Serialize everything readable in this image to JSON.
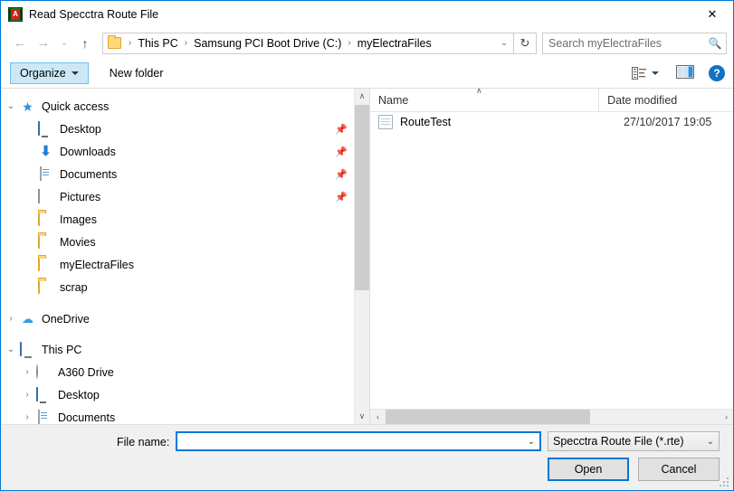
{
  "window": {
    "title": "Read Specctra Route File",
    "icon": "app-chip-icon",
    "close_label": "✕",
    "accent_color": "#0078d7"
  },
  "nav": {
    "back": "←",
    "forward": "→",
    "recent": "⌄",
    "up": "↑",
    "refresh": "↻",
    "address_chevron": "⌄"
  },
  "address": {
    "folder_icon": "folder-icon",
    "separator": "›",
    "crumbs": [
      "This PC",
      "Samsung PCI Boot Drive (C:)",
      "myElectraFiles"
    ]
  },
  "search": {
    "placeholder": "Search myElectraFiles",
    "value": "",
    "icon": "search-icon"
  },
  "commandbar": {
    "organize_label": "Organize",
    "new_folder_label": "New folder",
    "view_icon": "view-layout-icon",
    "preview_pane_icon": "preview-pane-icon",
    "help_label": "?"
  },
  "sidebar": {
    "items": [
      {
        "label": "Quick access",
        "icon": "star-icon",
        "expander": "⌄",
        "expanded": true,
        "level": 0,
        "pinned": false
      },
      {
        "label": "Desktop",
        "icon": "desktop-icon",
        "expander": "",
        "level": 1,
        "pinned": true
      },
      {
        "label": "Downloads",
        "icon": "download-icon",
        "expander": "",
        "level": 1,
        "pinned": true
      },
      {
        "label": "Documents",
        "icon": "document-icon",
        "expander": "",
        "level": 1,
        "pinned": true
      },
      {
        "label": "Pictures",
        "icon": "pictures-icon",
        "expander": "",
        "level": 1,
        "pinned": true
      },
      {
        "label": "Images",
        "icon": "folder-icon",
        "expander": "",
        "level": 1,
        "pinned": false
      },
      {
        "label": "Movies",
        "icon": "folder-icon",
        "expander": "",
        "level": 1,
        "pinned": false
      },
      {
        "label": "myElectraFiles",
        "icon": "folder-icon",
        "expander": "",
        "level": 1,
        "pinned": false
      },
      {
        "label": "scrap",
        "icon": "folder-icon",
        "expander": "",
        "level": 1,
        "pinned": false
      },
      {
        "label": "OneDrive",
        "icon": "cloud-icon",
        "expander": "›",
        "expanded": false,
        "level": 0,
        "pinned": false
      },
      {
        "label": "This PC",
        "icon": "pc-icon",
        "expander": "⌄",
        "expanded": true,
        "level": 0,
        "pinned": false
      },
      {
        "label": "A360 Drive",
        "icon": "a360-icon",
        "expander": "›",
        "expanded": false,
        "level": 1,
        "pinned": false
      },
      {
        "label": "Desktop",
        "icon": "desktop-icon",
        "expander": "›",
        "expanded": false,
        "level": 1,
        "pinned": false
      },
      {
        "label": "Documents",
        "icon": "document-icon",
        "expander": "›",
        "expanded": false,
        "level": 1,
        "pinned": false
      }
    ],
    "scroll_up": "∧",
    "scroll_down": "∨"
  },
  "filelist": {
    "columns": [
      {
        "label": "Name",
        "sorted": true,
        "sort_caret": "∧"
      },
      {
        "label": "Date modified",
        "sorted": false
      }
    ],
    "rows": [
      {
        "name": "RouteTest",
        "date_modified": "27/10/2017 19:05",
        "icon": "text-file-icon"
      }
    ],
    "hscroll_left": "‹",
    "hscroll_right": "›"
  },
  "footer": {
    "filename_label": "File name:",
    "filename_value": "",
    "filename_placeholder": "",
    "filter_value": "Specctra Route File (*.rte)",
    "combo_arrow": "⌄",
    "open_label": "Open",
    "cancel_label": "Cancel"
  }
}
